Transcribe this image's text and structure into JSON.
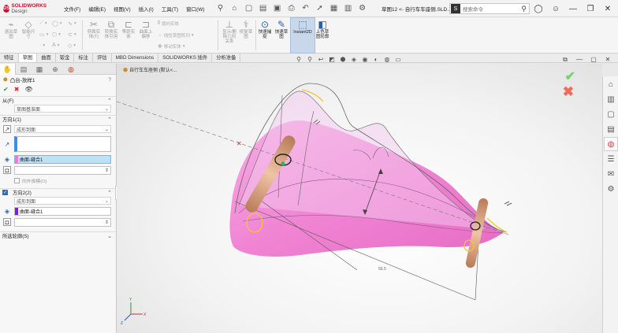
{
  "app": {
    "logo_text": "SOLIDWORKS",
    "logo_suffix": "Design"
  },
  "menu": [
    "文件(F)",
    "编辑(E)",
    "视图(V)",
    "插入(I)",
    "工具(T)",
    "窗口(W)"
  ],
  "doc_title": "草图12 <- 自行车车座侧.SLD...",
  "search": {
    "placeholder": "搜索命令",
    "badge": "S"
  },
  "ribbon": {
    "buttons": [
      {
        "label": "退出草\n图",
        "icon": "sketch-exit-icon"
      },
      {
        "label": "智能尺\n寸",
        "icon": "smart-dimension-icon"
      },
      {
        "label": "剪裁实\n体(T)",
        "icon": "trim-icon"
      },
      {
        "label": "转换实\n体引用",
        "icon": "convert-icon"
      },
      {
        "label": "等距实\n体",
        "icon": "offset-icon"
      },
      {
        "label": "曲面上\n偏移",
        "icon": "surface-offset-icon"
      },
      {
        "label": "显示/删\n除几何\n关系",
        "icon": "relations-icon"
      },
      {
        "label": "修复草\n图",
        "icon": "repair-icon"
      },
      {
        "label": "快速捕\n捉",
        "icon": "quick-snap-icon"
      },
      {
        "label": "快速草\n图",
        "icon": "rapid-sketch-icon"
      },
      {
        "label": "Instant2D",
        "icon": "instant2d-icon"
      },
      {
        "label": "上色草\n图轮廓",
        "icon": "shaded-contours-icon"
      }
    ],
    "small": [
      "镜向实体",
      "线性草图阵列",
      "移动实体"
    ]
  },
  "tabs": [
    "特征",
    "草图",
    "曲面",
    "钣金",
    "标注",
    "评估",
    "MBD Dimensions",
    "SOLIDWORKS 插件",
    "分析准备"
  ],
  "active_tab": "草图",
  "feature": {
    "title": "凸台-放样1",
    "help": "?",
    "from_label": "从(F)",
    "from_value": "草图基准面",
    "dir1_label": "方向1(1)",
    "dir1_value": "成形到面",
    "dir1_face": "曲面-缝合1",
    "outward_label": "向外拔模(O)",
    "dir2_label": "方向2(2)",
    "dir2_value": "成形到面",
    "dir2_face": "曲面-缝合1",
    "selected_contours": "所选轮廓(S)"
  },
  "viewport": {
    "breadcrumb": "自行车车座侧 (默认<...",
    "dim_label": "56.5"
  },
  "colors": {
    "accent_blue": "#3b8fe8",
    "pink_surface": "#f07ad0",
    "rod": "#d9a07a",
    "ok_green": "#7ad06b",
    "cancel_red": "#f06b5a",
    "purple_mark": "#7a1fd8"
  }
}
